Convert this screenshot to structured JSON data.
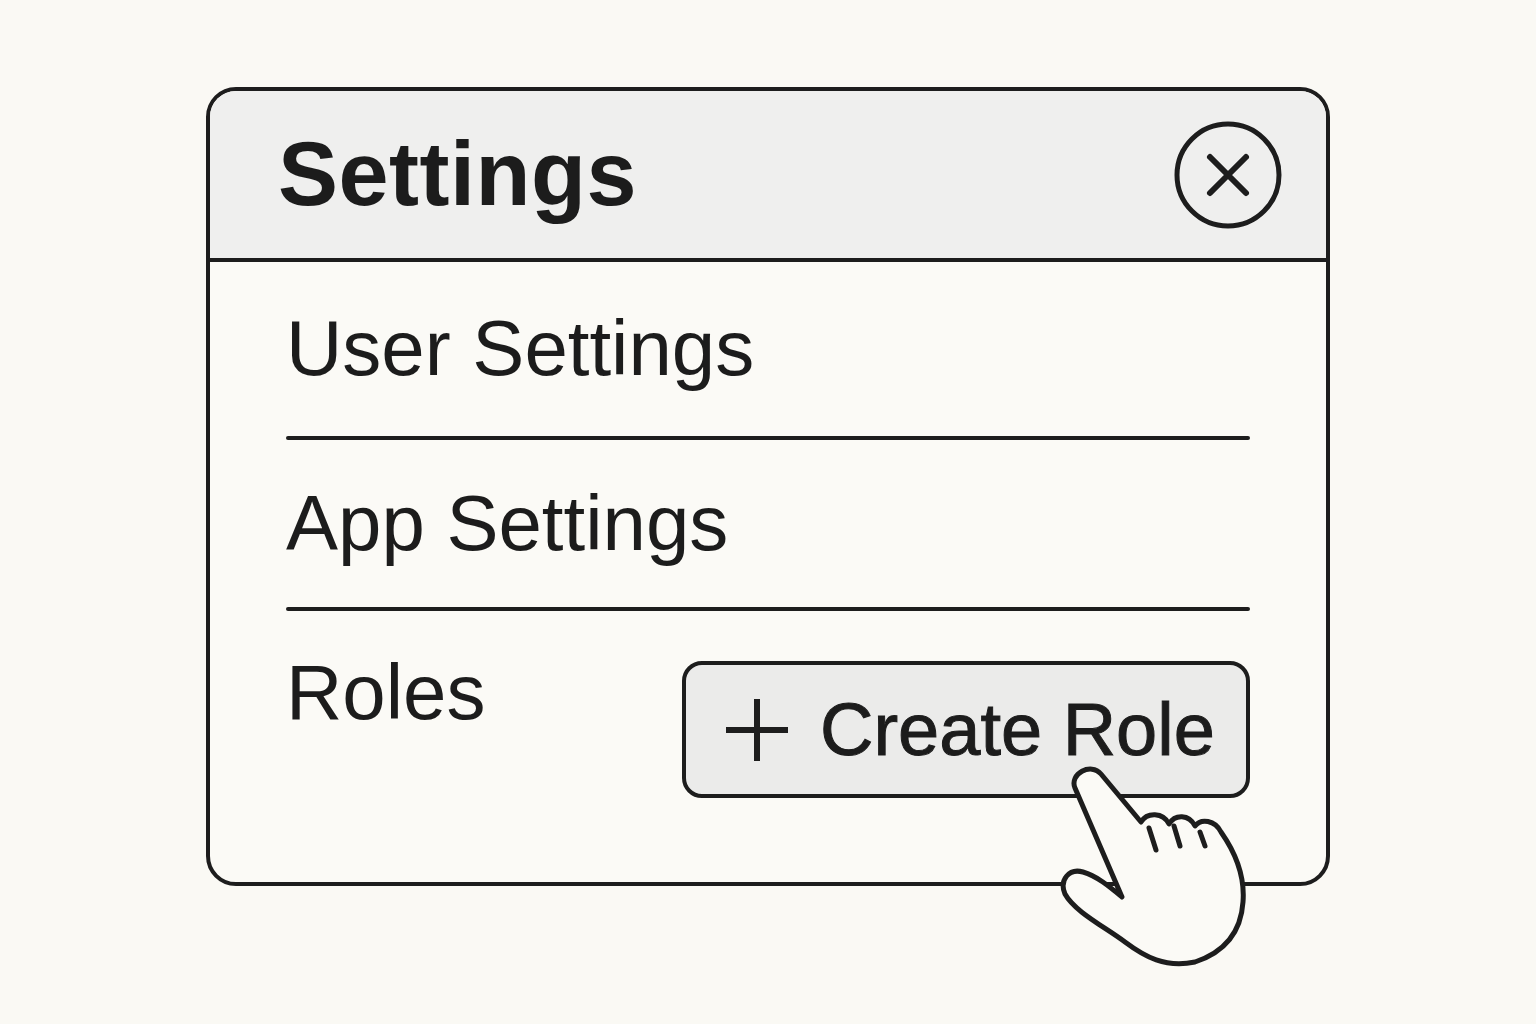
{
  "window": {
    "title": "Settings"
  },
  "sections": [
    {
      "label": "User Settings"
    },
    {
      "label": "App Settings"
    },
    {
      "label": "Roles",
      "button": {
        "label": "Create Role"
      }
    }
  ]
}
